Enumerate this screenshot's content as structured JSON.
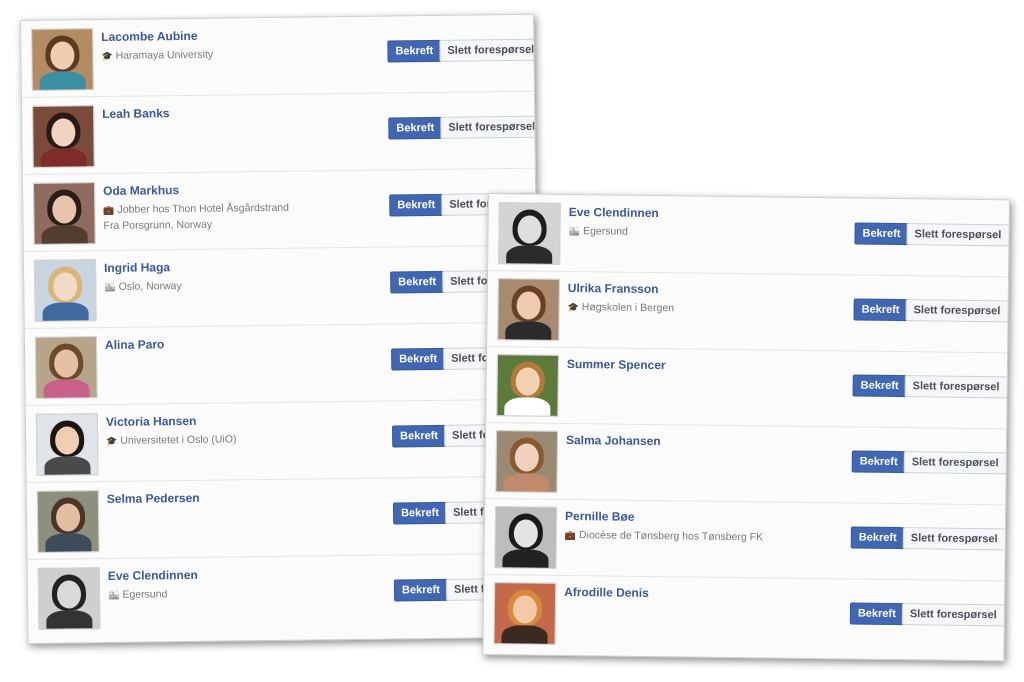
{
  "buttons": {
    "confirm": "Bekreft",
    "delete": "Slett forespørsel"
  },
  "left_list": [
    {
      "name": "Lacombe Aubine",
      "detail1": "Haramaya University",
      "detail1_icon": "graduation-cap-icon",
      "detail2": ""
    },
    {
      "name": "Leah Banks",
      "detail1": "",
      "detail1_icon": "",
      "detail2": ""
    },
    {
      "name": "Oda Markhus",
      "detail1": "Jobber hos Thon Hotel Åsgårdstrand",
      "detail1_icon": "briefcase-icon",
      "detail2": "Fra Porsgrunn, Norway"
    },
    {
      "name": "Ingrid Haga",
      "detail1": "Oslo, Norway",
      "detail1_icon": "city-icon",
      "detail2": ""
    },
    {
      "name": "Alina Paro",
      "detail1": "",
      "detail1_icon": "",
      "detail2": ""
    },
    {
      "name": "Victoria Hansen",
      "detail1": "Universitetet i Oslo (UiO)",
      "detail1_icon": "graduation-cap-icon",
      "detail2": ""
    },
    {
      "name": "Selma Pedersen",
      "detail1": "",
      "detail1_icon": "",
      "detail2": ""
    },
    {
      "name": "Eve Clendinnen",
      "detail1": "Egersund",
      "detail1_icon": "city-icon",
      "detail2": ""
    }
  ],
  "right_list": [
    {
      "name": "Eve Clendinnen",
      "detail1": "Egersund",
      "detail1_icon": "city-icon",
      "detail2": ""
    },
    {
      "name": "Ulrika Fransson",
      "detail1": "Høgskolen i Bergen",
      "detail1_icon": "graduation-cap-icon",
      "detail2": ""
    },
    {
      "name": "Summer Spencer",
      "detail1": "",
      "detail1_icon": "",
      "detail2": ""
    },
    {
      "name": "Salma Johansen",
      "detail1": "",
      "detail1_icon": "",
      "detail2": ""
    },
    {
      "name": "Pernille Bøe",
      "detail1": "Diocèse de Tønsberg hos Tønsberg FK",
      "detail1_icon": "briefcase-icon",
      "detail2": ""
    },
    {
      "name": "Afrodille Denis",
      "detail1": "",
      "detail1_icon": "",
      "detail2": ""
    }
  ]
}
